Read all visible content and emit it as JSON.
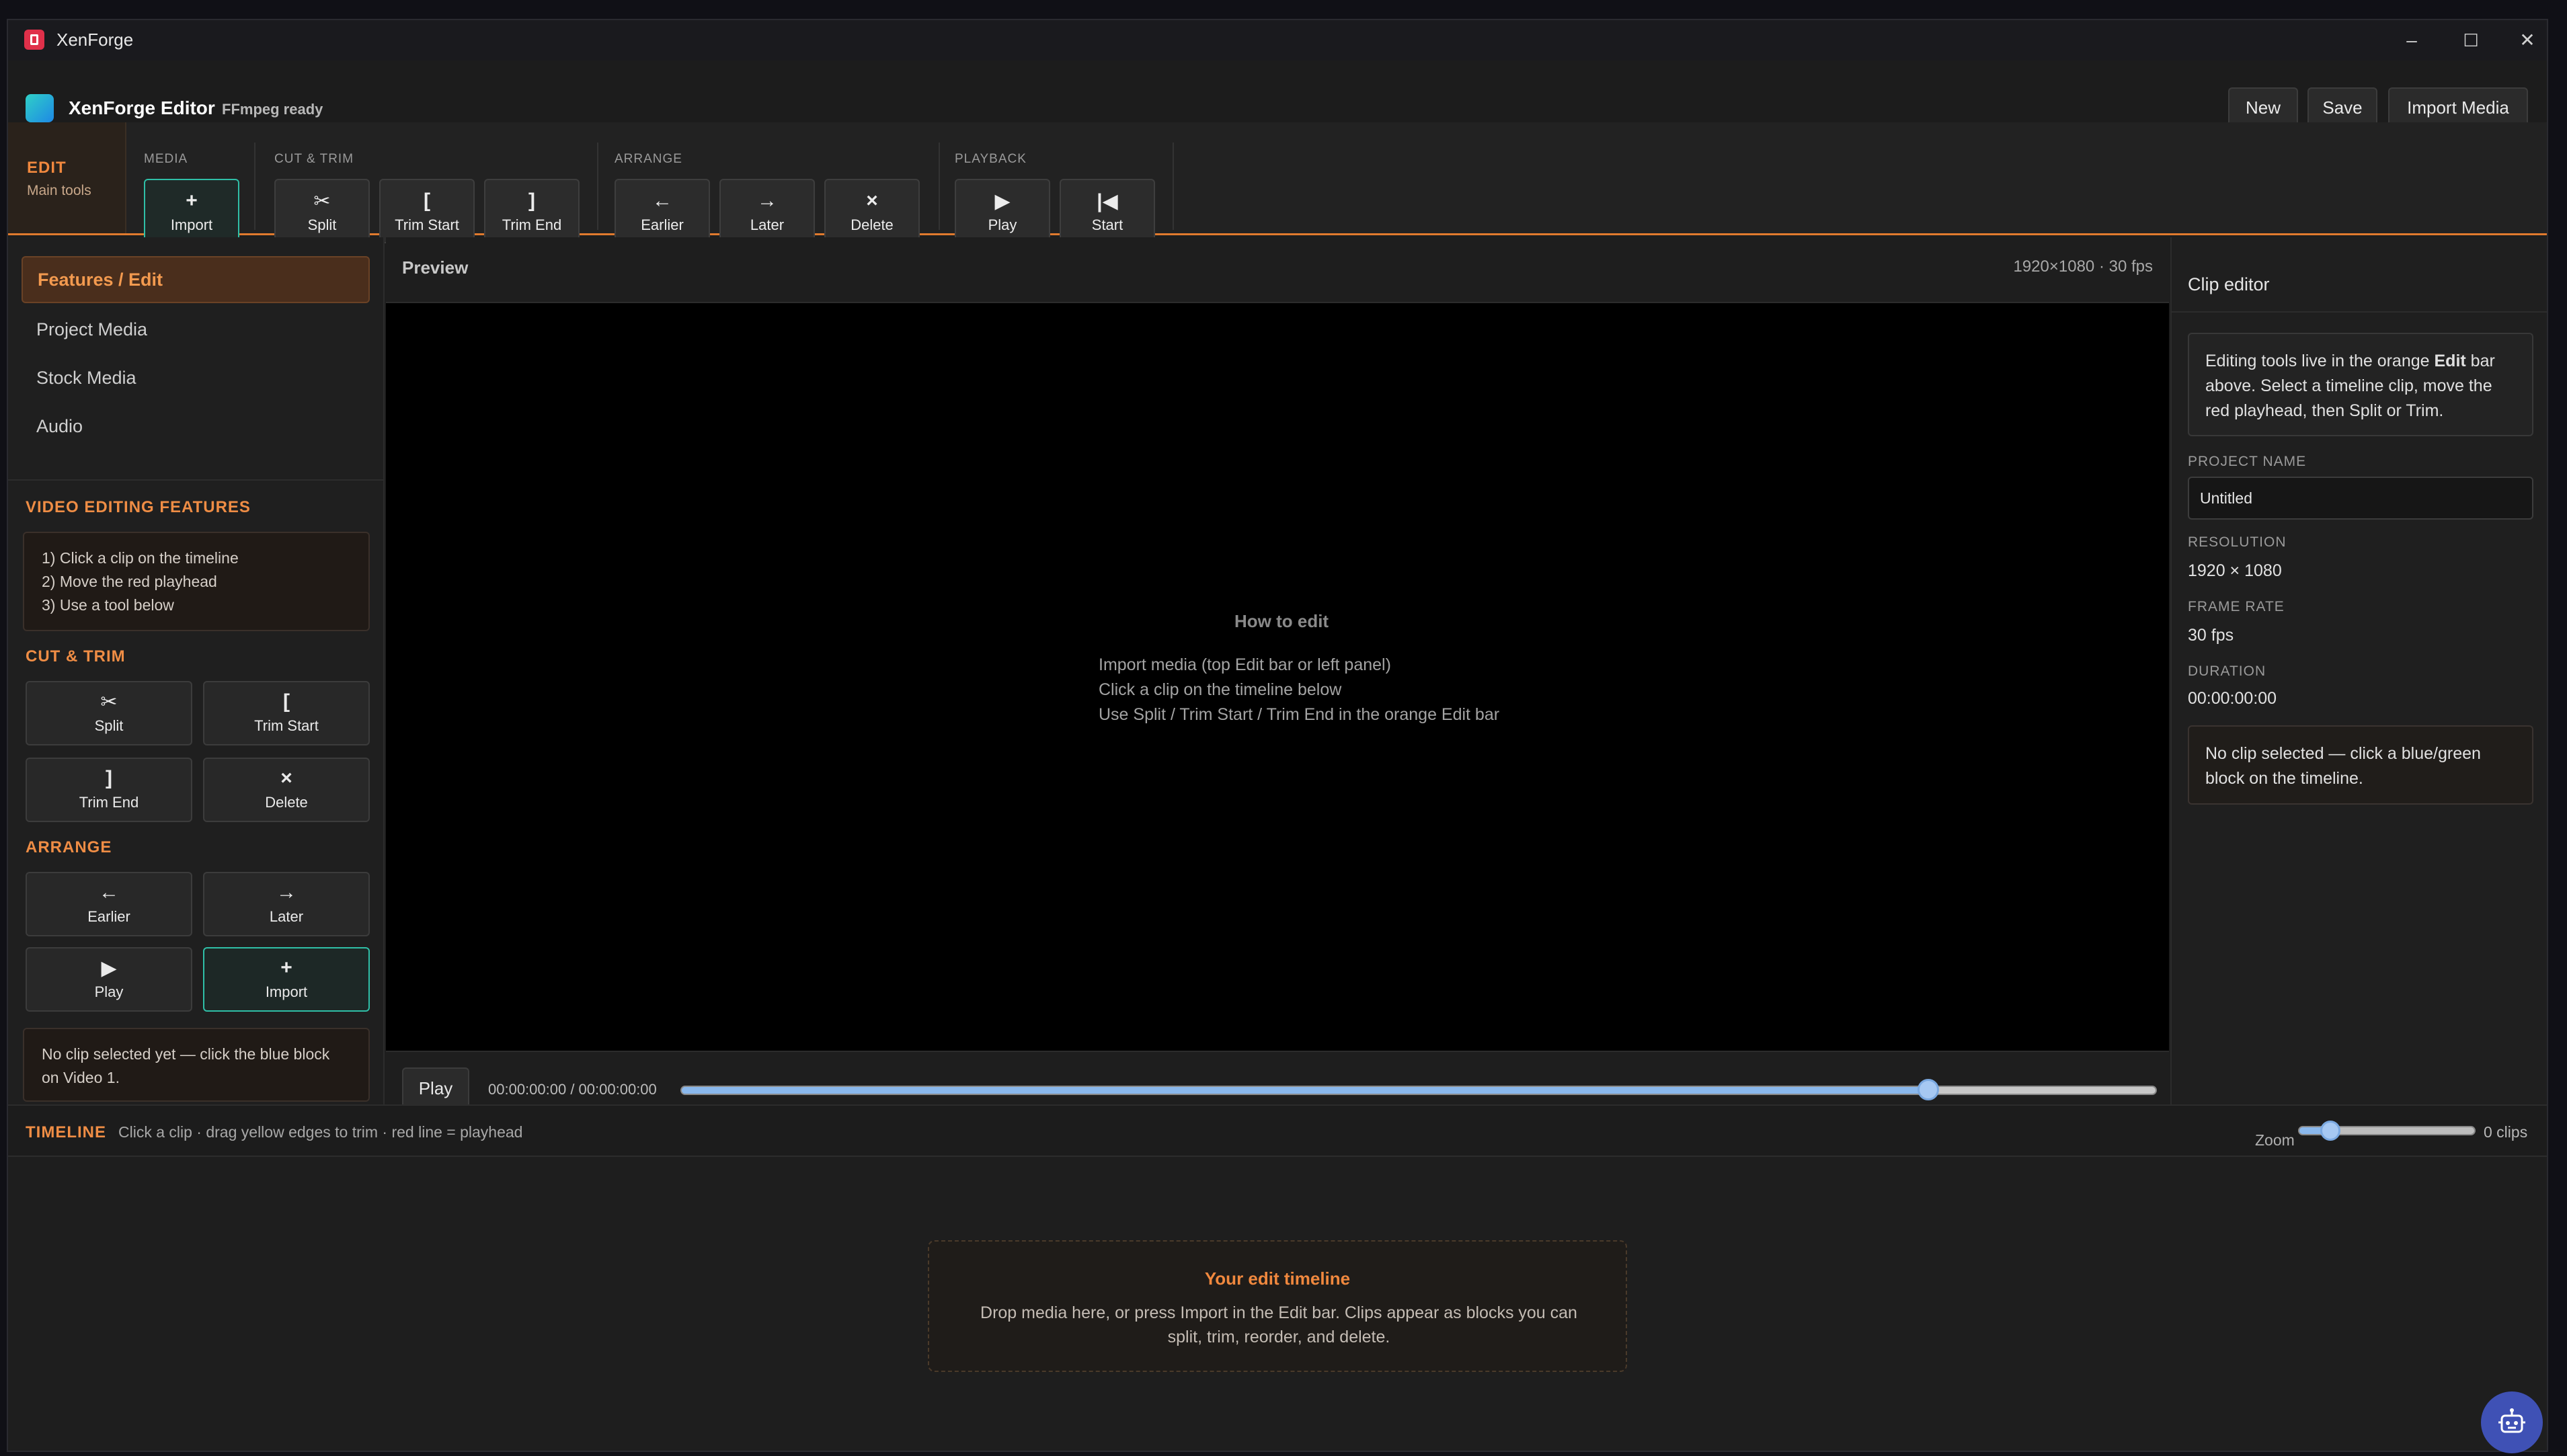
{
  "window": {
    "title": "XenForge",
    "controls": {
      "minimize": "–",
      "maximize": "☐",
      "close": "✕"
    }
  },
  "header": {
    "brand": "XenForge Editor",
    "status": "FFmpeg ready",
    "buttons": {
      "new": "New",
      "save": "Save",
      "import_media": "Import Media"
    }
  },
  "ribbon": {
    "tab_label": "EDIT",
    "tab_sub": "Main tools",
    "groups": {
      "media": "MEDIA",
      "cut_trim": "CUT & TRIM",
      "arrange": "ARRANGE",
      "playback": "PLAYBACK"
    },
    "buttons": {
      "import": {
        "icon": "+",
        "label": "Import"
      },
      "split": {
        "icon": "✂",
        "label": "Split"
      },
      "trim_start": {
        "icon": "[",
        "label": "Trim Start"
      },
      "trim_end": {
        "icon": "]",
        "label": "Trim End"
      },
      "earlier": {
        "icon": "←",
        "label": "Earlier"
      },
      "later": {
        "icon": "→",
        "label": "Later"
      },
      "delete": {
        "icon": "×",
        "label": "Delete"
      },
      "play": {
        "icon": "▶",
        "label": "Play"
      },
      "start": {
        "icon": "|◀",
        "label": "Start"
      }
    }
  },
  "sidebar": {
    "nav": [
      "Features / Edit",
      "Project Media",
      "Stock Media",
      "Audio"
    ],
    "features_title": "VIDEO EDITING FEATURES",
    "steps": [
      "1) Click a clip on the timeline",
      "2) Move the red playhead",
      "3) Use a tool below"
    ],
    "cut_trim_title": "CUT & TRIM",
    "arrange_title": "ARRANGE",
    "buttons": {
      "split": {
        "icon": "✂",
        "label": "Split"
      },
      "trim_start": {
        "icon": "[",
        "label": "Trim Start"
      },
      "trim_end": {
        "icon": "]",
        "label": "Trim End"
      },
      "delete": {
        "icon": "×",
        "label": "Delete"
      },
      "earlier": {
        "icon": "←",
        "label": "Earlier"
      },
      "later": {
        "icon": "→",
        "label": "Later"
      },
      "play": {
        "icon": "▶",
        "label": "Play"
      },
      "import": {
        "icon": "+",
        "label": "Import"
      }
    },
    "status": "No clip selected yet — click the blue block on Video 1."
  },
  "preview": {
    "title": "Preview",
    "meta": "1920×1080 · 30 fps",
    "howto_title": "How to edit",
    "howto_lines": [
      "Import media (top Edit bar or left panel)",
      "Click a clip on the timeline below",
      "Use Split / Trim Start / Trim End in the orange Edit bar"
    ],
    "play_label": "Play",
    "time": "00:00:00:00 / 00:00:00:00",
    "scrub_position": 0.845
  },
  "clip_editor": {
    "title": "Clip editor",
    "intro_before": "Editing tools live in the orange ",
    "intro_bold": "Edit",
    "intro_after": " bar above. Select a timeline clip, move the red playhead, then Split or Trim.",
    "project_name_label": "PROJECT NAME",
    "project_name_value": "Untitled",
    "resolution_label": "RESOLUTION",
    "resolution_value": "1920 × 1080",
    "frame_rate_label": "FRAME RATE",
    "frame_rate_value": "30 fps",
    "duration_label": "DURATION",
    "duration_value": "00:00:00:00",
    "no_clip": "No clip selected — click a blue/green block on the timeline."
  },
  "timeline": {
    "title": "TIMELINE",
    "hint": "Click a clip · drag yellow edges to trim · red line = playhead",
    "zoom_label": "Zoom",
    "zoom_level": 0.18,
    "clip_count": "0 clips",
    "empty_title": "Your edit timeline",
    "empty_text": "Drop media here, or press Import in the Edit bar. Clips appear as blocks you can split, trim, reorder, and delete."
  },
  "colors": {
    "accent_orange": "#f0883e",
    "accent_teal": "#2fbfa7",
    "slider_blue": "#8ab8ec",
    "assistant": "#3f51b5"
  },
  "icons": {
    "assistant": "robot-icon",
    "app": "app-logo-icon",
    "brand": "brand-logo-icon"
  }
}
